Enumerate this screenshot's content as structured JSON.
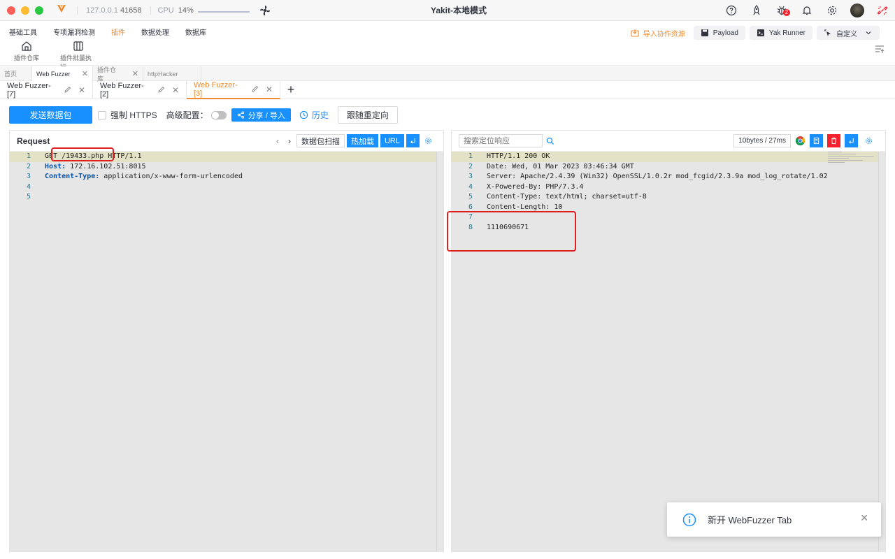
{
  "titlebar": {
    "address": "127.0.0.1",
    "port": "41658",
    "cpu_label": "CPU",
    "cpu_value": "14%",
    "app_title": "Yakit-本地模式",
    "notification_badge": "2"
  },
  "menu": {
    "items": [
      "基础工具",
      "专项漏洞检测",
      "插件",
      "数据处理",
      "数据库"
    ],
    "active_item": "插件",
    "sub_items": [
      "插件仓库",
      "插件批量执行"
    ],
    "import_link": "导入协作资源",
    "payload_label": "Payload",
    "yak_runner_label": "Yak Runner",
    "custom_label": "自定义"
  },
  "page_tabs": [
    {
      "label": "首页",
      "closable": false
    },
    {
      "label": "Web Fuzzer",
      "closable": true
    },
    {
      "label": "插件仓库",
      "closable": true
    },
    {
      "label": "httpHacker",
      "closable": false
    }
  ],
  "fuzzer_tabs": [
    {
      "label": "Web Fuzzer-[7]"
    },
    {
      "label": "Web Fuzzer-[2]"
    },
    {
      "label": "Web Fuzzer-[3]"
    }
  ],
  "toolbar": {
    "send_label": "发送数据包",
    "force_https_label": "强制 HTTPS",
    "advanced_label": "高级配置：",
    "share_label": "分享 / 导入",
    "history_label": "历史",
    "redirect_label": "跟随重定向"
  },
  "request_panel": {
    "title": "Request",
    "scan_label": "数据包扫描",
    "hotload_label": "热加载",
    "url_label": "URL",
    "lines": [
      {
        "no": "1",
        "key": "",
        "text": "GET /19433.php HTTP/1.1"
      },
      {
        "no": "2",
        "key": "Host:",
        "text": " 172.16.102.51:8015"
      },
      {
        "no": "3",
        "key": "Content-Type:",
        "text": " application/x-www-form-urlencoded"
      },
      {
        "no": "4",
        "key": "",
        "text": ""
      },
      {
        "no": "5",
        "key": "",
        "text": ""
      }
    ]
  },
  "response_panel": {
    "search_placeholder": "搜索定位响应",
    "meta": "10bytes / 27ms",
    "lines": [
      {
        "no": "1",
        "text": "HTTP/1.1 200 OK"
      },
      {
        "no": "2",
        "text": "Date: Wed, 01 Mar 2023 03:46:34 GMT"
      },
      {
        "no": "3",
        "text": "Server: Apache/2.4.39 (Win32) OpenSSL/1.0.2r mod_fcgid/2.3.9a mod_log_rotate/1.02"
      },
      {
        "no": "4",
        "text": "X-Powered-By: PHP/7.3.4"
      },
      {
        "no": "5",
        "text": "Content-Type: text/html; charset=utf-8"
      },
      {
        "no": "6",
        "text": "Content-Length: 10"
      },
      {
        "no": "7",
        "text": ""
      },
      {
        "no": "8",
        "text": "1110690671"
      }
    ]
  },
  "toast": {
    "message": "新开 WebFuzzer Tab"
  },
  "colors": {
    "accent": "#f28b30",
    "primary": "#1890ff",
    "annotation": "#e02020"
  }
}
